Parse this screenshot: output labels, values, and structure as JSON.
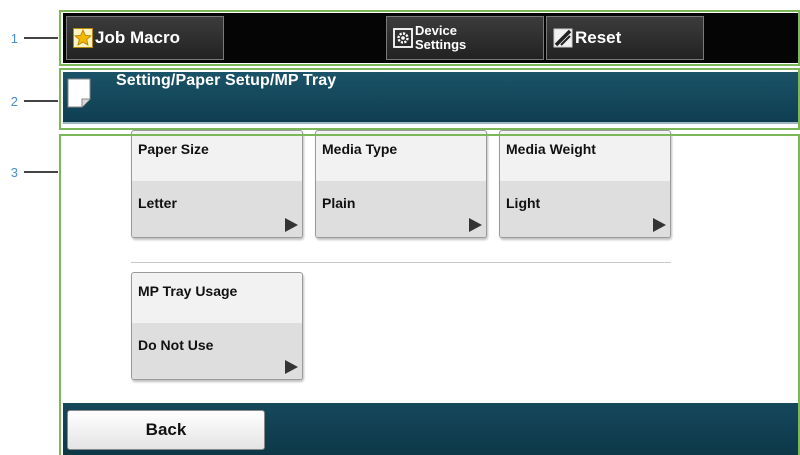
{
  "callouts": [
    "1",
    "2",
    "3"
  ],
  "toolbar": {
    "job_macro": {
      "label": "Job Macro",
      "icon": "star-icon"
    },
    "device_settings": {
      "line1": "Device",
      "line2": "Settings",
      "icon": "gear-icon"
    },
    "reset": {
      "label": "Reset",
      "icon": "reset-icon"
    }
  },
  "header": {
    "title": "Setting/Paper Setup/MP Tray",
    "icon": "document-icon"
  },
  "settings": [
    {
      "label": "Paper Size",
      "value": "Letter"
    },
    {
      "label": "Media Type",
      "value": "Plain"
    },
    {
      "label": "Media Weight",
      "value": "Light"
    },
    {
      "label": "MP Tray Usage",
      "value": "Do Not Use"
    }
  ],
  "footer": {
    "back_label": "Back"
  },
  "colors": {
    "outline": "#7cb85a",
    "header_bg": "#1b5368",
    "toolbar_bg": "#050505",
    "callout_text": "#4a8fd0"
  }
}
